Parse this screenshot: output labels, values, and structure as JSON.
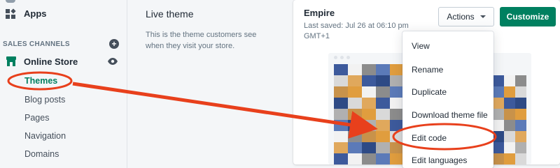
{
  "sidebar": {
    "apps_label": "Apps",
    "sales_channels_label": "SALES CHANNELS",
    "online_store_label": "Online Store",
    "items": [
      {
        "label": "Themes"
      },
      {
        "label": "Blog posts"
      },
      {
        "label": "Pages"
      },
      {
        "label": "Navigation"
      },
      {
        "label": "Domains"
      }
    ]
  },
  "live_theme": {
    "title": "Live theme",
    "description": "This is the theme customers see when they visit your store."
  },
  "theme_card": {
    "name": "Empire",
    "last_saved": "Last saved: Jul 26 at 06:10 pm GMT+1",
    "actions_label": "Actions",
    "customize_label": "Customize"
  },
  "actions_menu": {
    "items": [
      {
        "label": "View"
      },
      {
        "label": "Rename"
      },
      {
        "label": "Duplicate"
      },
      {
        "label": "Download theme file"
      },
      {
        "label": "Edit code"
      },
      {
        "label": "Edit languages"
      }
    ]
  },
  "colors": {
    "accent_green": "#008060",
    "annotation_red": "#e8401c"
  },
  "icons": {
    "apps": "apps-grid-icon",
    "add": "plus-circle-icon",
    "store": "store-icon",
    "view": "eye-icon"
  }
}
